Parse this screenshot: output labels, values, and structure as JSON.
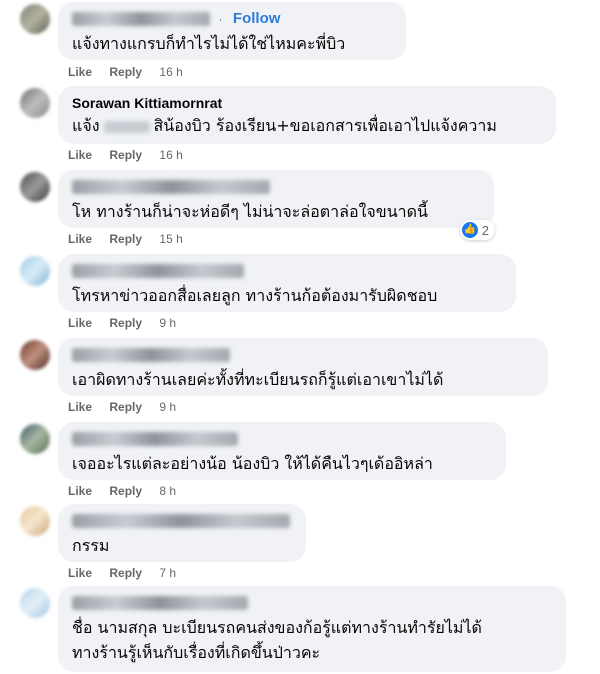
{
  "comments": [
    {
      "name": "",
      "follow_label": "Follow",
      "text_lines": [
        "แจ้งทางแกรบก็ทำไรไม่ได้ใช่ไหมคะพี่บิว"
      ],
      "like_label": "Like",
      "reply_label": "Reply",
      "time": "16 h"
    },
    {
      "name": "Sorawan Kittiamornrat",
      "text_before": "แจ้ง",
      "text_after": "สิน้องบิว ร้องเรียน+ขอเอกสารเพื่อเอาไปแจ้งความ",
      "like_label": "Like",
      "reply_label": "Reply",
      "time": "16 h"
    },
    {
      "name": "",
      "text_lines": [
        "โห ทางร้านก็น่าจะห่อดีๆ ไม่น่าจะล่อตาล่อใจขนาดนี้"
      ],
      "like_label": "Like",
      "reply_label": "Reply",
      "time": "15 h",
      "reaction_count": "2"
    },
    {
      "name": "",
      "text_lines": [
        "โทรหาข่าวออกสื่อเลยลูก ทางร้านก้อต้องมารับผิดชอบ"
      ],
      "like_label": "Like",
      "reply_label": "Reply",
      "time": "9 h"
    },
    {
      "name": "",
      "text_lines": [
        "เอาผิดทางร้านเลยค่ะทั้งที่ทะเบียนรถก็รู้แต่เอาเขาไม่ได้"
      ],
      "like_label": "Like",
      "reply_label": "Reply",
      "time": "9 h"
    },
    {
      "name": "",
      "text_lines": [
        "เจออะไรแต่ละอย่างน้อ น้องบิว ให้ได้คืนไวๆเด้ออิหล่า"
      ],
      "like_label": "Like",
      "reply_label": "Reply",
      "time": "8 h"
    },
    {
      "name": "",
      "text_lines": [
        "กรรม"
      ],
      "like_label": "Like",
      "reply_label": "Reply",
      "time": "7 h"
    },
    {
      "name": "",
      "text_lines": [
        "ชื่อ นามสกุล บะเบียนรถคนส่งของก้อรู้แต่ทางร้านทำรัยไม่ได้",
        "ทางร้านรู้เห็นกับเรื่องที่เกิดขึ้นป่าวคะ"
      ]
    }
  ],
  "colors": {
    "bubble": "#f0f2f5",
    "follow": "#2f7bd8",
    "meta": "#65676b",
    "like_reaction": "#1877f2"
  }
}
